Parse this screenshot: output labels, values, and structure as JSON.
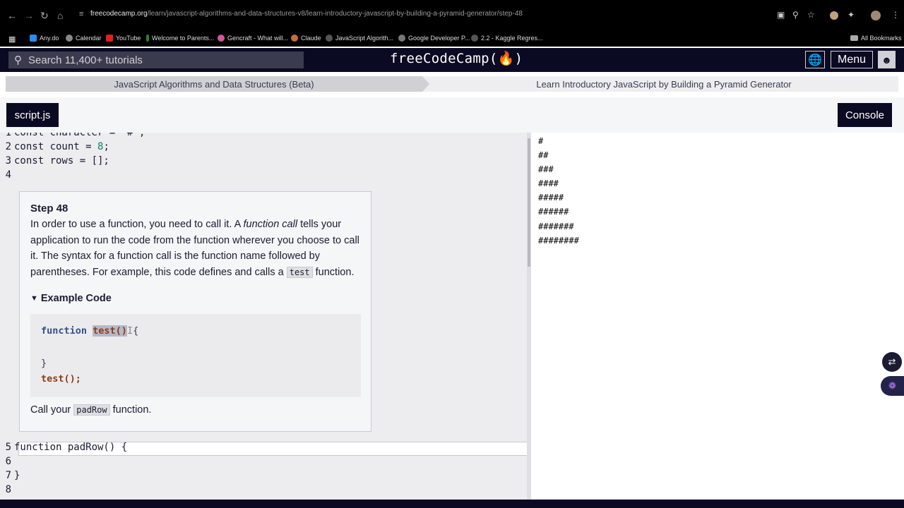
{
  "browser": {
    "url_host": "freecodecamp.org",
    "url_path": "/learn/javascript-algorithms-and-data-structures-v8/learn-introductory-javascript-by-building-a-pyramid-generator/step-48",
    "bookmarks": [
      {
        "label": "Any.do",
        "color": "#2a8bf2"
      },
      {
        "label": "Calendar",
        "color": "#888"
      },
      {
        "label": "YouTube",
        "color": "#e02020"
      },
      {
        "label": "Welcome to Parents...",
        "color": "#2e7d32"
      },
      {
        "label": "Gencraft - What will...",
        "color": "#d4569a"
      },
      {
        "label": "Claude",
        "color": "#c86a3e"
      },
      {
        "label": "JavaScript Algorith...",
        "color": "#555"
      },
      {
        "label": "Google Developer P...",
        "color": "#777"
      },
      {
        "label": "2.2 - Kaggle Regres...",
        "color": "#555"
      }
    ],
    "all_bookmarks": "All Bookmarks"
  },
  "header": {
    "search_placeholder": "Search 11,400+ tutorials",
    "logo": "freeCodeCamp(🔥)",
    "menu_label": "Menu"
  },
  "breadcrumb": {
    "course": "JavaScript Algorithms and Data Structures (Beta)",
    "project": "Learn Introductory JavaScript by Building a Pyramid Generator"
  },
  "tabs": {
    "script": "script.js",
    "console": "Console"
  },
  "code_top": [
    {
      "n": "1",
      "text": "const character = \"#\";"
    },
    {
      "n": "2",
      "pre": "const count = ",
      "num": "8",
      "post": ";"
    },
    {
      "n": "3",
      "text": "const rows = [];"
    },
    {
      "n": "4",
      "text": ""
    }
  ],
  "step": {
    "title": "Step 48",
    "para_a": "In order to use a function, you need to call it. A ",
    "para_em": "function call",
    "para_b": " tells your application to run the code from the function wherever you choose to call it. The syntax for a function call is the function name followed by parentheses. For example, this code defines and calls a ",
    "para_code": "test",
    "para_c": " function.",
    "example_label": "Example Code",
    "example": {
      "kw": "function",
      "name": "test()",
      "open": "{",
      "close": "}",
      "call": "test();"
    },
    "call_a": "Call your ",
    "call_code": "padRow",
    "call_b": " function."
  },
  "code_bottom": [
    {
      "n": "5",
      "text": "function padRow() {"
    },
    {
      "n": "6",
      "text": ""
    },
    {
      "n": "7",
      "text": "}"
    },
    {
      "n": "8",
      "text": ""
    }
  ],
  "preview_lines": [
    "#",
    "##",
    "###",
    "####",
    "#####",
    "######",
    "#######",
    "########"
  ]
}
